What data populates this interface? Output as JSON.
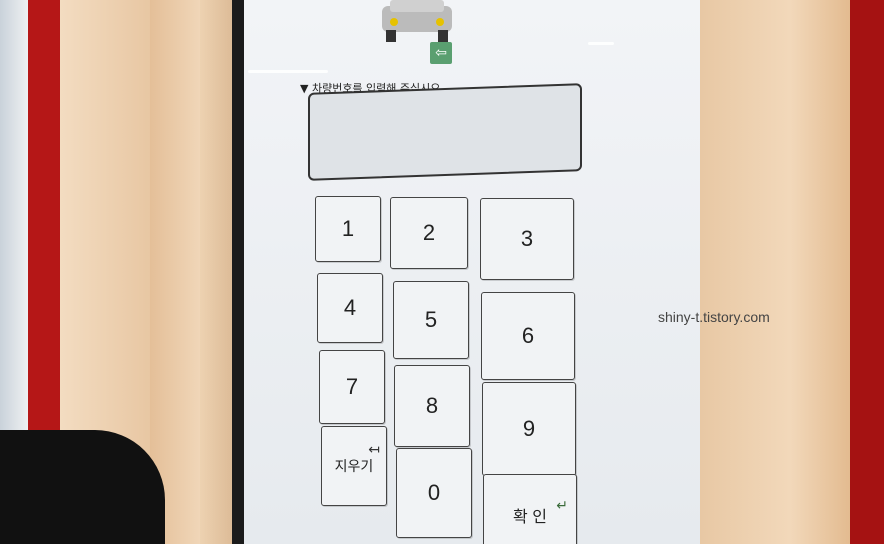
{
  "kiosk": {
    "instruction": "▼ 차량번호를 입력해 주십시오",
    "plate_value": "",
    "keypad": {
      "k1": "1",
      "k2": "2",
      "k3": "3",
      "k4": "4",
      "k5": "5",
      "k6": "6",
      "k7": "7",
      "k8": "8",
      "k9": "9",
      "delete": "지우기",
      "k0": "0",
      "confirm": "확 인"
    }
  },
  "watermark": "shiny-t.tistory.com"
}
